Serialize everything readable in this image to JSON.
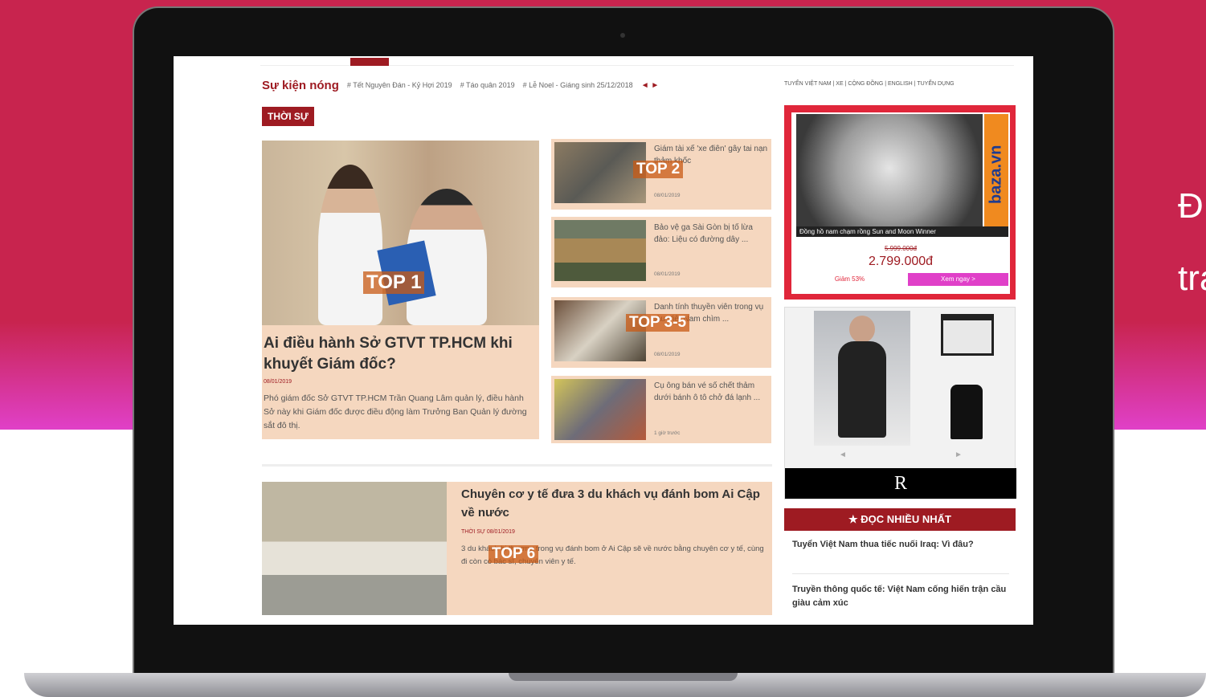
{
  "side_text": {
    "line1": "Đ",
    "line2": "tra"
  },
  "site": {
    "hot_label": "Sự kiện nóng",
    "hot_items": [
      "# Tết Nguyên Đán - Kỷ Hợi 2019",
      "# Táo quân 2019",
      "# Lễ Noel - Giáng sinh 25/12/2018"
    ],
    "hot_arrows": "◄ ►",
    "category_links": "TUYỂN VIỆT NAM | XE | CỘNG ĐỒNG | ENGLISH | TUYỂN DỤNG",
    "section": "THỜI SỰ"
  },
  "main_story": {
    "tag": "TOP 1",
    "title": "Ai điều hành Sở GTVT TP.HCM khi khuyết Giám đốc?",
    "date": "08/01/2019",
    "snippet": "Phó giám đốc Sở GTVT TP.HCM Trần Quang Lâm quản lý, điều hành Sở này khi Giám đốc được điều động làm Trưởng Ban Quản lý đường sắt đô thị."
  },
  "side_stories": [
    {
      "tag": "TOP 2",
      "title": "Giám tài xế 'xe điên' gây tai nạn thảm khốc",
      "meta": "08/01/2019"
    },
    {
      "tag": "",
      "title": "Bảo vệ ga Sài Gòn bị tố lừa đảo: Liệu có đường dây ...",
      "meta": "08/01/2019"
    },
    {
      "tag": "TOP 3-5",
      "title": "Danh tính thuyền viên trong vụ tàu Việt Nam chìm ...",
      "meta": "08/01/2019"
    },
    {
      "tag": "",
      "title": "Cụ ông bán vé số chết thảm dưới bánh ô tô chở đá lạnh ...",
      "meta": "1 giờ trước"
    }
  ],
  "second_story": {
    "tag": "TOP 6",
    "title": "Chuyên cơ y tế đưa 3 du khách vụ đánh bom Ai Cập về nước",
    "meta": "THỜI SỰ  08/01/2019",
    "snippet": "3 du khách bị thương trong vụ đánh bom ở Ai Cập sẽ về nước bằng chuyên cơ y tế, cùng đi còn có bác sĩ, chuyên viên y tế."
  },
  "ad1": {
    "brand": "baza.vn",
    "caption": "Đồng hồ nam chạm rồng Sun and Moon Winner",
    "old_price": "5.999.000đ",
    "price": "2.799.000đ",
    "discount": "Giảm 53%",
    "buy": "Xem ngay >"
  },
  "ad2": {
    "arrows_left": "◄",
    "arrows_right": "►",
    "logo": "R"
  },
  "most_read": {
    "header": "ĐỌC NHIỀU NHẤT",
    "items": [
      "Tuyển Việt Nam thua tiếc nuối Iraq: Vì đâu?",
      "Truyền thông quốc tế: Việt Nam cống hiến trận cầu giàu cảm xúc"
    ]
  }
}
